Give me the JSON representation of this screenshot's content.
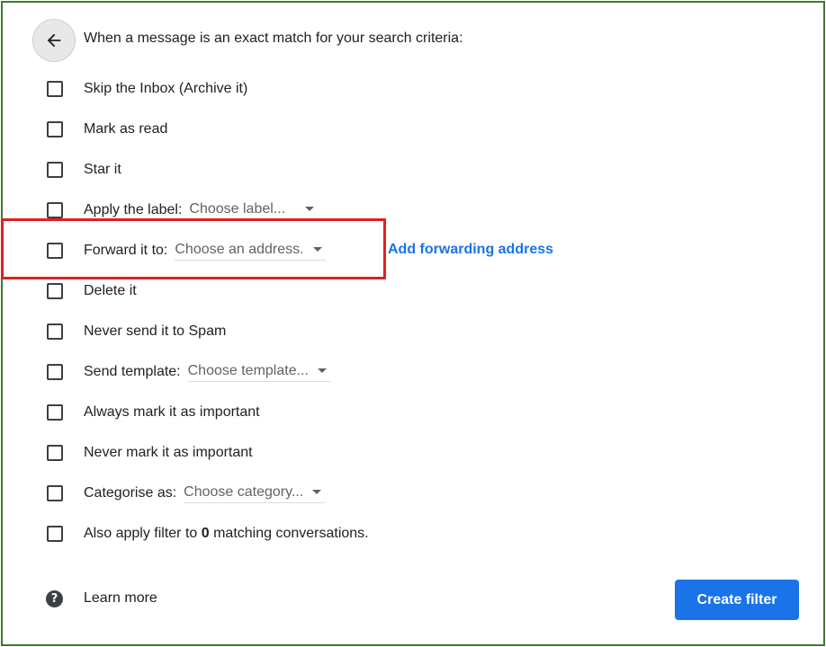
{
  "header": {
    "text": "When a message is an exact match for your search criteria:"
  },
  "options": {
    "skip_inbox": "Skip the Inbox (Archive it)",
    "mark_read": "Mark as read",
    "star": "Star it",
    "apply_label": {
      "label": "Apply the label:",
      "select": "Choose label..."
    },
    "forward": {
      "label": "Forward it to:",
      "select": "Choose an address."
    },
    "delete": "Delete it",
    "never_spam": "Never send it to Spam",
    "send_template": {
      "label": "Send template:",
      "select": "Choose template..."
    },
    "always_important": "Always mark it as important",
    "never_important": "Never mark it as important",
    "categorise": {
      "label": "Categorise as:",
      "select": "Choose category..."
    },
    "also_apply": {
      "prefix": "Also apply filter to ",
      "count": "0",
      "suffix": " matching conversations."
    }
  },
  "add_forwarding_link": "Add forwarding address",
  "footer": {
    "help_icon": "?",
    "learn_more": "Learn more",
    "create_filter": "Create filter"
  },
  "colors": {
    "accent": "#1a73e8",
    "highlight": "#e02020",
    "frame": "#3b7a2a"
  }
}
